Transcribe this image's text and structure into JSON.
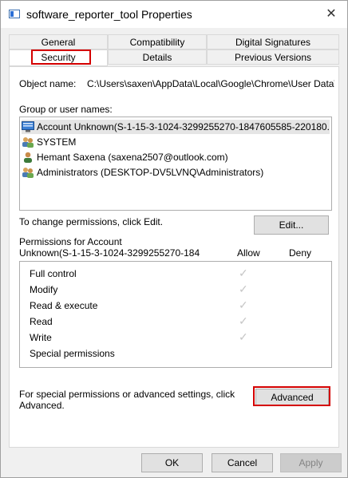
{
  "window": {
    "title": "software_reporter_tool Properties",
    "close_glyph": "✕"
  },
  "tabs": {
    "row1": [
      "General",
      "Compatibility",
      "Digital Signatures"
    ],
    "row2": [
      "Security",
      "Details",
      "Previous Versions"
    ],
    "active": "Security"
  },
  "security": {
    "object_name_label": "Object name:",
    "object_name_value": "C:\\Users\\saxen\\AppData\\Local\\Google\\Chrome\\User Data\\S",
    "group_label": "Group or user names:",
    "users": [
      "Account Unknown(S-1-15-3-1024-3299255270-1847605585-220180...",
      "SYSTEM",
      "Hemant Saxena (saxena2507@outlook.com)",
      "Administrators (DESKTOP-DV5LVNQ\\Administrators)"
    ],
    "change_text": "To change permissions, click Edit.",
    "edit_button": "Edit...",
    "perm_label_line1": "Permissions for Account",
    "perm_label_line2": "Unknown(S-1-15-3-1024-3299255270-184",
    "allow_header": "Allow",
    "deny_header": "Deny",
    "permissions": [
      {
        "name": "Full control",
        "allow": true
      },
      {
        "name": "Modify",
        "allow": true
      },
      {
        "name": "Read & execute",
        "allow": true
      },
      {
        "name": "Read",
        "allow": true
      },
      {
        "name": "Write",
        "allow": true
      },
      {
        "name": "Special permissions",
        "allow": false
      }
    ],
    "check_glyph": "✓",
    "special_text_line1": "For special permissions or advanced settings, click",
    "special_text_line2": "Advanced.",
    "advanced_button": "Advanced"
  },
  "footer": {
    "ok": "OK",
    "cancel": "Cancel",
    "apply": "Apply"
  },
  "colors": {
    "highlight": "#d40000",
    "selected_row": "#e5e5e5",
    "check": "#c6c6c6"
  }
}
